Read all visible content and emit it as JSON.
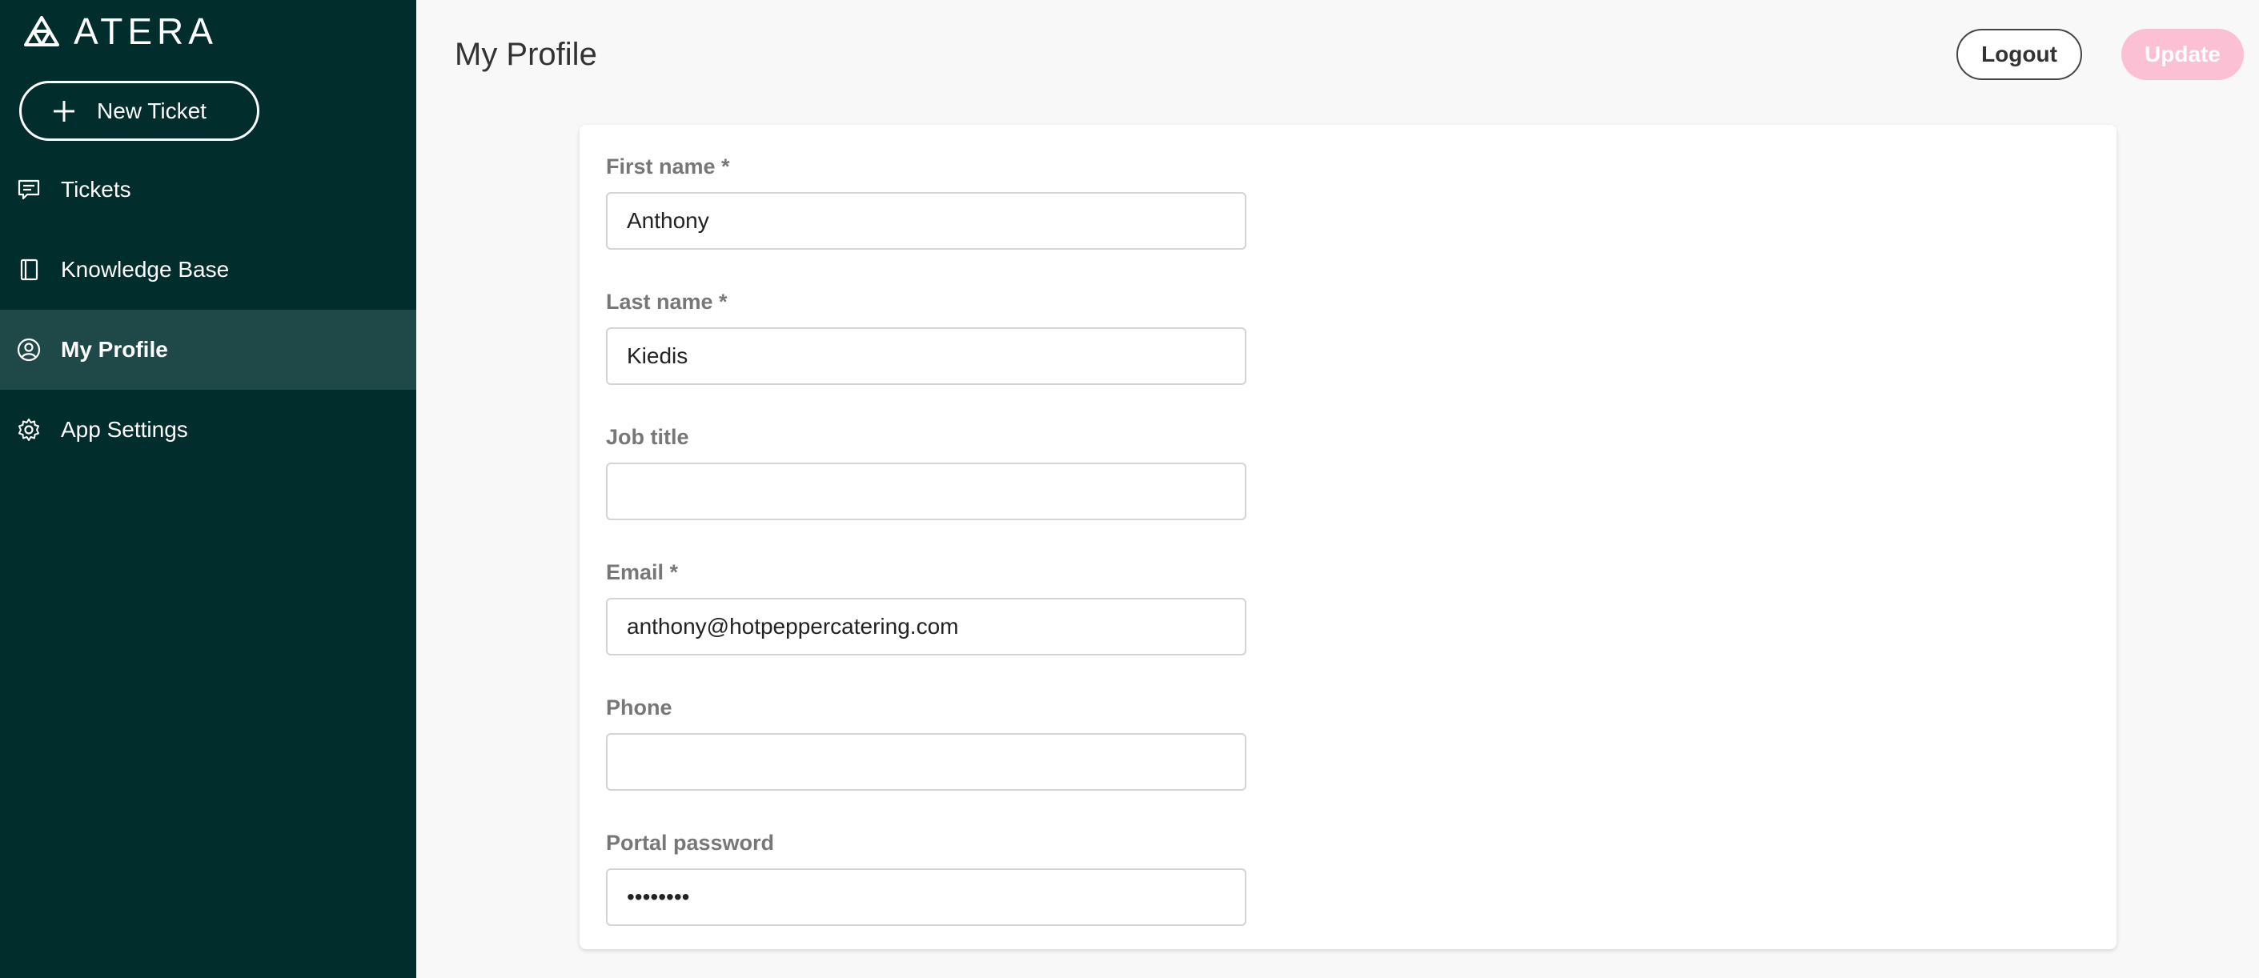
{
  "sidebar": {
    "logo_text": "ATERA",
    "new_ticket_label": "New Ticket",
    "items": [
      {
        "label": "Tickets",
        "icon": "chat-icon"
      },
      {
        "label": "Knowledge Base",
        "icon": "book-icon"
      },
      {
        "label": "My Profile",
        "icon": "user-circle-icon",
        "active": true
      },
      {
        "label": "App Settings",
        "icon": "gear-icon"
      }
    ]
  },
  "header": {
    "title": "My Profile",
    "logout_label": "Logout",
    "update_label": "Update"
  },
  "form": {
    "first_name": {
      "label": "First name *",
      "value": "Anthony"
    },
    "last_name": {
      "label": "Last name *",
      "value": "Kiedis"
    },
    "job_title": {
      "label": "Job title",
      "value": ""
    },
    "email": {
      "label": "Email *",
      "value": "anthony@hotpeppercatering.com"
    },
    "phone": {
      "label": "Phone",
      "value": ""
    },
    "portal_password": {
      "label": "Portal password",
      "value": "********"
    }
  },
  "colors": {
    "sidebar_bg": "#022d2d",
    "sidebar_active": "#1f4848",
    "update_button": "#fcc0d4"
  }
}
